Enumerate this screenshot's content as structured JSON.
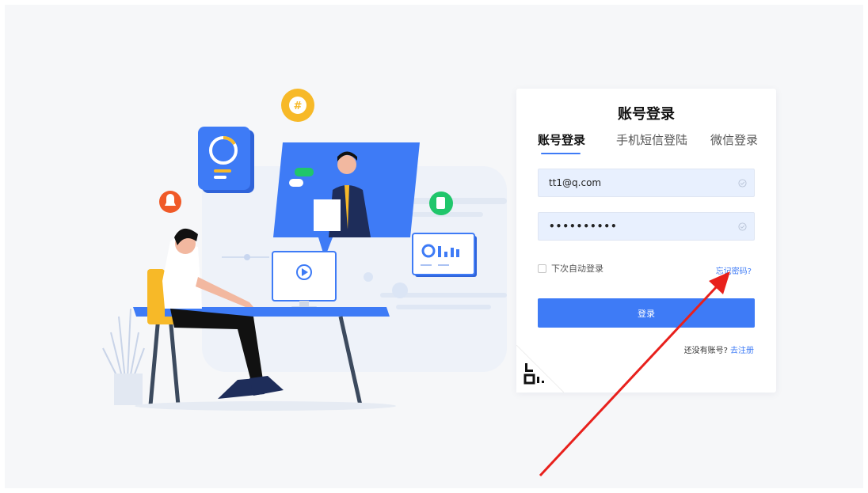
{
  "login": {
    "title": "账号登录",
    "tabs": [
      {
        "label": "账号登录",
        "active": true
      },
      {
        "label": "手机短信登陆",
        "active": false
      },
      {
        "label": "微信登录",
        "active": false
      }
    ],
    "username_value": "tt1@q.com",
    "password_value": "••••••••••",
    "remember_label": "下次自动登录",
    "remember_checked": false,
    "forgot_label": "忘记密码?",
    "submit_label": "登录",
    "no_account_text": "还没有账号?",
    "register_link": "去注册"
  },
  "colors": {
    "accent": "#3e7bf6",
    "input_bg": "#e8f0fe",
    "page_bg": "#f6f7f9",
    "annotation_arrow": "#e8201c"
  },
  "icons": [
    "bell-icon",
    "hashtag-chat-icon",
    "document-icon",
    "play-icon",
    "chart-icon",
    "qr-code-icon",
    "check-circle-icon"
  ]
}
